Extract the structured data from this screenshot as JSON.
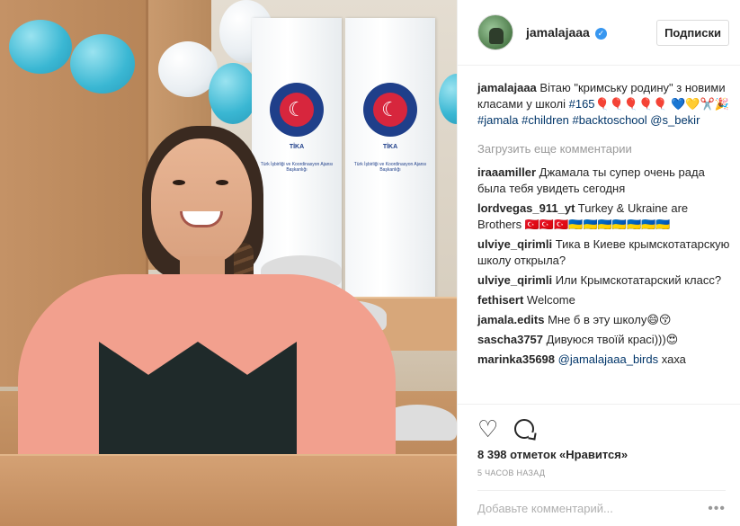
{
  "header": {
    "username": "jamalajaaa",
    "follow_label": "Подписки"
  },
  "caption": {
    "username": "jamalajaaa",
    "text": "Вітаю \"кримську родину\" з новими класами у школі #165🎈🎈🎈🎈🎈 💙💛✂️🎉#jamala #children #backtoschool @s_bekir"
  },
  "load_more": "Загрузить еще комментарии",
  "comments": [
    {
      "user": "iraaamiller",
      "text": "Джамала ты супер очень рада была тебя увидеть сегодня"
    },
    {
      "user": "lordvegas_911_yt",
      "text": "Turkey & Ukraine are Brothers 🇹🇷🇹🇷🇹🇷🇺🇦🇺🇦🇺🇦🇺🇦🇺🇦🇺🇦🇺🇦"
    },
    {
      "user": "ulviye_qirimli",
      "text": "Тика в Киеве крымскотатарскую школу открыла?"
    },
    {
      "user": "ulviye_qirimli",
      "text": "Или Крымскотатарский класс?"
    },
    {
      "user": "fethisert",
      "text": "Welcome"
    },
    {
      "user": "jamala.edits",
      "text": "Мне б в эту школу😄😚"
    },
    {
      "user": "sascha3757",
      "text": "Дивуюся твоїй красі)))😍"
    },
    {
      "user": "marinka35698",
      "text": "@jamalajaaa_birds хаха"
    }
  ],
  "likes": "8 398 отметок «Нравится»",
  "timestamp": "5 часов назад",
  "add_comment_placeholder": "Добавьте комментарий...",
  "photo": {
    "banner_text": "TİKA",
    "banner_sub": "Türk İşbirliği ve Koordinasyon Ajansı Başkanlığı"
  },
  "icons": {
    "like": "heart-icon",
    "comment": "comment-icon",
    "more": "more-options-icon",
    "verified": "verified-badge-icon"
  },
  "colors": {
    "verified": "#3897f0",
    "link": "#003569",
    "muted": "#999999"
  }
}
